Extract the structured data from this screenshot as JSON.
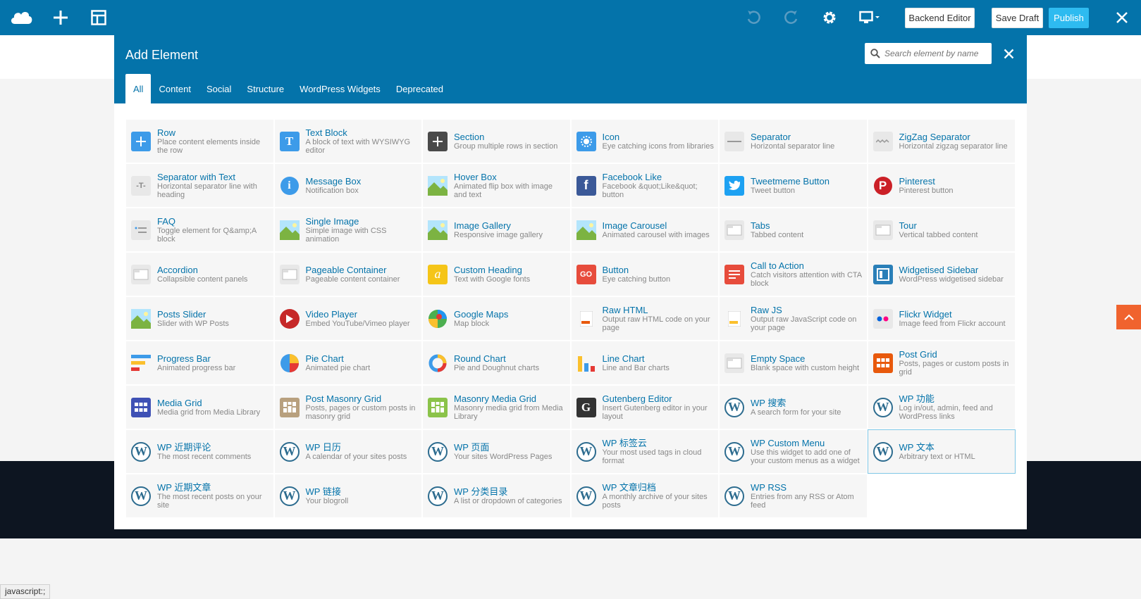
{
  "topbar": {
    "backend_editor": "Backend Editor",
    "save_draft": "Save Draft",
    "publish": "Publish",
    "accent": "#0473aa"
  },
  "status_bar": "javascript:;",
  "modal": {
    "title": "Add Element",
    "search_placeholder": "Search element by name",
    "tabs": [
      "All",
      "Content",
      "Social",
      "Structure",
      "WordPress Widgets",
      "Deprecated"
    ],
    "active_tab": "All"
  },
  "elements": [
    {
      "name": "Row",
      "desc": "Place content elements inside the row",
      "icon": "plus-icon",
      "color": "#3d9be9"
    },
    {
      "name": "Text Block",
      "desc": "A block of text with WYSIWYG editor",
      "icon": "text-icon",
      "color": "#3d9be9"
    },
    {
      "name": "Section",
      "desc": "Group multiple rows in section",
      "icon": "plus-icon",
      "color": "#4a4a4a"
    },
    {
      "name": "Icon",
      "desc": "Eye catching icons from libraries",
      "icon": "sun-icon",
      "color": "#3d9be9"
    },
    {
      "name": "Separator",
      "desc": "Horizontal separator line",
      "icon": "separator-icon",
      "color": "#e5e5e5"
    },
    {
      "name": "ZigZag Separator",
      "desc": "Horizontal zigzag separator line",
      "icon": "zigzag-icon",
      "color": "#e5e5e5"
    },
    {
      "name": "Separator with Text",
      "desc": "Horizontal separator line with heading",
      "icon": "separator-text-icon",
      "color": "#e5e5e5"
    },
    {
      "name": "Message Box",
      "desc": "Notification box",
      "icon": "info-icon",
      "color": "#3d9be9"
    },
    {
      "name": "Hover Box",
      "desc": "Animated flip box with image and text",
      "icon": "image-icon",
      "color": "#7cb342"
    },
    {
      "name": "Facebook Like",
      "desc": "Facebook &quot;Like&quot; button",
      "icon": "facebook-icon",
      "color": "#3b5998"
    },
    {
      "name": "Tweetmeme Button",
      "desc": "Tweet button",
      "icon": "twitter-icon",
      "color": "#1da1f2"
    },
    {
      "name": "Pinterest",
      "desc": "Pinterest button",
      "icon": "pinterest-icon",
      "color": "#cb2027"
    },
    {
      "name": "FAQ",
      "desc": "Toggle element for Q&amp;A block",
      "icon": "faq-icon",
      "color": "#e5e5e5"
    },
    {
      "name": "Single Image",
      "desc": "Simple image with CSS animation",
      "icon": "image-icon",
      "color": "#7cb342"
    },
    {
      "name": "Image Gallery",
      "desc": "Responsive image gallery",
      "icon": "gallery-icon",
      "color": "#7cb342"
    },
    {
      "name": "Image Carousel",
      "desc": "Animated carousel with images",
      "icon": "carousel-icon",
      "color": "#7cb342"
    },
    {
      "name": "Tabs",
      "desc": "Tabbed content",
      "icon": "tabs-icon",
      "color": "#e5e5e5"
    },
    {
      "name": "Tour",
      "desc": "Vertical tabbed content",
      "icon": "tour-icon",
      "color": "#e5e5e5"
    },
    {
      "name": "Accordion",
      "desc": "Collapsible content panels",
      "icon": "accordion-icon",
      "color": "#e5e5e5"
    },
    {
      "name": "Pageable Container",
      "desc": "Pageable content container",
      "icon": "pageable-icon",
      "color": "#e5e5e5"
    },
    {
      "name": "Custom Heading",
      "desc": "Text with Google fonts",
      "icon": "heading-icon",
      "color": "#f5c518"
    },
    {
      "name": "Button",
      "desc": "Eye catching button",
      "icon": "go-button-icon",
      "color": "#e74c3c"
    },
    {
      "name": "Call to Action",
      "desc": "Catch visitors attention with CTA block",
      "icon": "cta-icon",
      "color": "#e74c3c"
    },
    {
      "name": "Widgetised Sidebar",
      "desc": "WordPress widgetised sidebar",
      "icon": "sidebar-icon",
      "color": "#2a7fb8"
    },
    {
      "name": "Posts Slider",
      "desc": "Slider with WP Posts",
      "icon": "slider-icon",
      "color": "#7cb342"
    },
    {
      "name": "Video Player",
      "desc": "Embed YouTube/Vimeo player",
      "icon": "play-icon",
      "color": "#c62828"
    },
    {
      "name": "Google Maps",
      "desc": "Map block",
      "icon": "map-icon",
      "color": "#4caf50"
    },
    {
      "name": "Raw HTML",
      "desc": "Output raw HTML code on your page",
      "icon": "html-icon",
      "color": "#f0f0f0"
    },
    {
      "name": "Raw JS",
      "desc": "Output raw JavaScript code on your page",
      "icon": "js-icon",
      "color": "#f0f0f0"
    },
    {
      "name": "Flickr Widget",
      "desc": "Image feed from Flickr account",
      "icon": "flickr-icon",
      "color": "#e5e5e5"
    },
    {
      "name": "Progress Bar",
      "desc": "Animated progress bar",
      "icon": "progress-icon",
      "color": "#ffffff"
    },
    {
      "name": "Pie Chart",
      "desc": "Animated pie chart",
      "icon": "pie-icon",
      "color": "#ffffff"
    },
    {
      "name": "Round Chart",
      "desc": "Pie and Doughnut charts",
      "icon": "donut-icon",
      "color": "#ffffff"
    },
    {
      "name": "Line Chart",
      "desc": "Line and Bar charts",
      "icon": "bar-chart-icon",
      "color": "#ffffff"
    },
    {
      "name": "Empty Space",
      "desc": "Blank space with custom height",
      "icon": "empty-space-icon",
      "color": "#e5e5e5"
    },
    {
      "name": "Post Grid",
      "desc": "Posts, pages or custom posts in grid",
      "icon": "grid-icon",
      "color": "#e8590c"
    },
    {
      "name": "Media Grid",
      "desc": "Media grid from Media Library",
      "icon": "grid-icon",
      "color": "#3f51b5"
    },
    {
      "name": "Post Masonry Grid",
      "desc": "Posts, pages or custom posts in masonry grid",
      "icon": "masonry-icon",
      "color": "#b8a07e"
    },
    {
      "name": "Masonry Media Grid",
      "desc": "Masonry media grid from Media Library",
      "icon": "masonry-icon",
      "color": "#8bc34a"
    },
    {
      "name": "Gutenberg Editor",
      "desc": "Insert Gutenberg editor in your layout",
      "icon": "gutenberg-icon",
      "color": "#333333"
    },
    {
      "name": "WP 搜索",
      "desc": "A search form for your site",
      "icon": "wordpress-icon",
      "color": "#2d6c8f"
    },
    {
      "name": "WP 功能",
      "desc": "Log in/out, admin, feed and WordPress links",
      "icon": "wordpress-icon",
      "color": "#2d6c8f"
    },
    {
      "name": "WP 近期评论",
      "desc": "The most recent comments",
      "icon": "wordpress-icon",
      "color": "#2d6c8f"
    },
    {
      "name": "WP 日历",
      "desc": "A calendar of your sites posts",
      "icon": "wordpress-icon",
      "color": "#2d6c8f"
    },
    {
      "name": "WP 页面",
      "desc": "Your sites WordPress Pages",
      "icon": "wordpress-icon",
      "color": "#2d6c8f"
    },
    {
      "name": "WP 标签云",
      "desc": "Your most used tags in cloud format",
      "icon": "wordpress-icon",
      "color": "#2d6c8f"
    },
    {
      "name": "WP Custom Menu",
      "desc": "Use this widget to add one of your custom menus as a widget",
      "icon": "wordpress-icon",
      "color": "#2d6c8f"
    },
    {
      "name": "WP 文本",
      "desc": "Arbitrary text or HTML",
      "icon": "wordpress-icon",
      "color": "#2d6c8f"
    },
    {
      "name": "WP 近期文章",
      "desc": "The most recent posts on your site",
      "icon": "wordpress-icon",
      "color": "#2d6c8f"
    },
    {
      "name": "WP 链接",
      "desc": "Your blogroll",
      "icon": "wordpress-icon",
      "color": "#2d6c8f"
    },
    {
      "name": "WP 分类目录",
      "desc": "A list or dropdown of categories",
      "icon": "wordpress-icon",
      "color": "#2d6c8f"
    },
    {
      "name": "WP 文章归档",
      "desc": "A monthly archive of your sites posts",
      "icon": "wordpress-icon",
      "color": "#2d6c8f"
    },
    {
      "name": "WP RSS",
      "desc": "Entries from any RSS or Atom feed",
      "icon": "wordpress-icon",
      "color": "#2d6c8f"
    }
  ]
}
